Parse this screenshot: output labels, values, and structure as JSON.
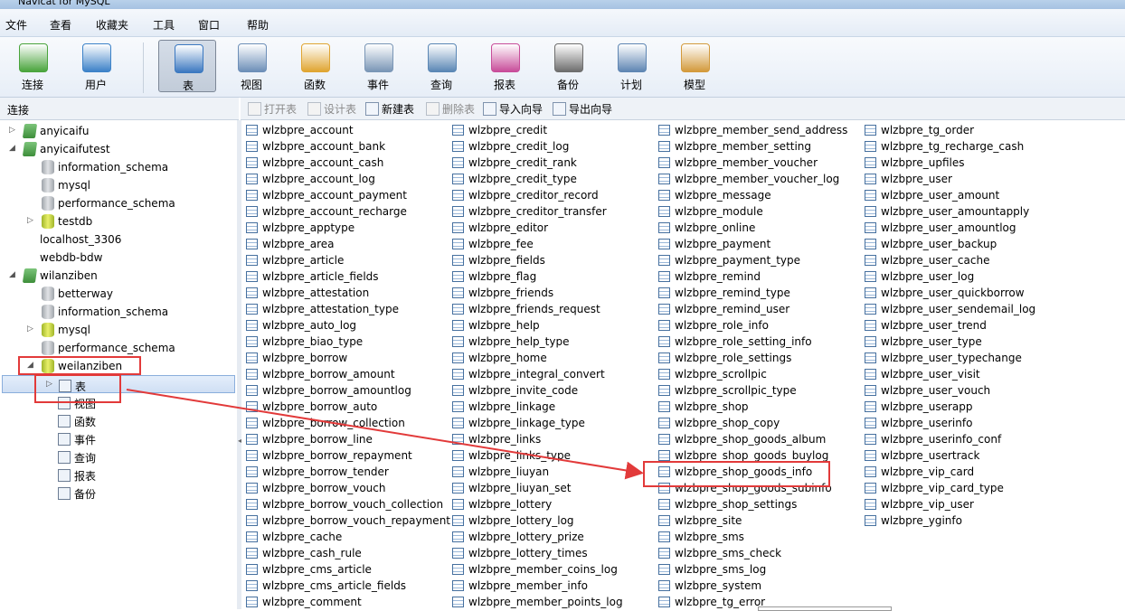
{
  "window": {
    "title": "Navicat for MySQL"
  },
  "menu": [
    "文件",
    "查看",
    "收藏夹",
    "工具",
    "窗口",
    "帮助"
  ],
  "toolbar": [
    {
      "label": "连接",
      "icon": "connection-icon",
      "color": "#4aa43c"
    },
    {
      "label": "用户",
      "icon": "user-icon",
      "color": "#3d82c8"
    },
    {
      "label": "表",
      "icon": "table-icon",
      "color": "#3b78c0"
    },
    {
      "label": "视图",
      "icon": "view-icon",
      "color": "#6d8fb8"
    },
    {
      "label": "函数",
      "icon": "function-icon",
      "color": "#e0a532"
    },
    {
      "label": "事件",
      "icon": "event-icon",
      "color": "#7a96b6"
    },
    {
      "label": "查询",
      "icon": "query-icon",
      "color": "#5b87b5"
    },
    {
      "label": "报表",
      "icon": "report-icon",
      "color": "#c84d9a"
    },
    {
      "label": "备份",
      "icon": "backup-icon",
      "color": "#6e6e6e"
    },
    {
      "label": "计划",
      "icon": "schedule-icon",
      "color": "#5f86b3"
    },
    {
      "label": "模型",
      "icon": "model-icon",
      "color": "#d39a3c"
    }
  ],
  "connection_header": "连接",
  "object_toolbar": [
    {
      "label": "打开表",
      "enabled": false
    },
    {
      "label": "设计表",
      "enabled": false
    },
    {
      "label": "新建表",
      "enabled": true
    },
    {
      "label": "删除表",
      "enabled": false
    },
    {
      "label": "导入向导",
      "enabled": true
    },
    {
      "label": "导出向导",
      "enabled": true
    }
  ],
  "tree": [
    {
      "label": "anyicaifu",
      "level": 0,
      "arrow": "▷",
      "icon": "conn"
    },
    {
      "label": "anyicaifutest",
      "level": 0,
      "arrow": "◢",
      "icon": "conn"
    },
    {
      "label": "information_schema",
      "level": 1,
      "arrow": "",
      "icon": "db"
    },
    {
      "label": "mysql",
      "level": 1,
      "arrow": "",
      "icon": "db"
    },
    {
      "label": "performance_schema",
      "level": 1,
      "arrow": "",
      "icon": "db"
    },
    {
      "label": "testdb",
      "level": 1,
      "arrow": "▷",
      "icon": "dbopen"
    },
    {
      "label": "localhost_3306",
      "level": 0,
      "arrow": "",
      "icon": "srv"
    },
    {
      "label": "webdb-bdw",
      "level": 0,
      "arrow": "",
      "icon": "srv"
    },
    {
      "label": "wilanziben",
      "level": 0,
      "arrow": "◢",
      "icon": "conn"
    },
    {
      "label": "betterway",
      "level": 1,
      "arrow": "",
      "icon": "db"
    },
    {
      "label": "information_schema",
      "level": 1,
      "arrow": "",
      "icon": "db"
    },
    {
      "label": "mysql",
      "level": 1,
      "arrow": "▷",
      "icon": "dbopen"
    },
    {
      "label": "performance_schema",
      "level": 1,
      "arrow": "",
      "icon": "db"
    },
    {
      "label": "weilanziben",
      "level": 1,
      "arrow": "◢",
      "icon": "dbopen"
    },
    {
      "label": "表",
      "level": 2,
      "arrow": "▷",
      "icon": "small",
      "selected": true
    },
    {
      "label": "视图",
      "level": 2,
      "arrow": "",
      "icon": "small"
    },
    {
      "label": "函数",
      "level": 2,
      "arrow": "",
      "icon": "small"
    },
    {
      "label": "事件",
      "level": 2,
      "arrow": "",
      "icon": "small"
    },
    {
      "label": "查询",
      "level": 2,
      "arrow": "",
      "icon": "small"
    },
    {
      "label": "报表",
      "level": 2,
      "arrow": "",
      "icon": "small"
    },
    {
      "label": "备份",
      "level": 2,
      "arrow": "",
      "icon": "small"
    }
  ],
  "table_columns": [
    [
      "wlzbpre_account",
      "wlzbpre_account_bank",
      "wlzbpre_account_cash",
      "wlzbpre_account_log",
      "wlzbpre_account_payment",
      "wlzbpre_account_recharge",
      "wlzbpre_apptype",
      "wlzbpre_area",
      "wlzbpre_article",
      "wlzbpre_article_fields",
      "wlzbpre_attestation",
      "wlzbpre_attestation_type",
      "wlzbpre_auto_log",
      "wlzbpre_biao_type",
      "wlzbpre_borrow",
      "wlzbpre_borrow_amount",
      "wlzbpre_borrow_amountlog",
      "wlzbpre_borrow_auto",
      "wlzbpre_borrow_collection",
      "wlzbpre_borrow_line",
      "wlzbpre_borrow_repayment",
      "wlzbpre_borrow_tender",
      "wlzbpre_borrow_vouch",
      "wlzbpre_borrow_vouch_collection",
      "wlzbpre_borrow_vouch_repayment",
      "wlzbpre_cache",
      "wlzbpre_cash_rule",
      "wlzbpre_cms_article",
      "wlzbpre_cms_article_fields",
      "wlzbpre_comment"
    ],
    [
      "wlzbpre_credit",
      "wlzbpre_credit_log",
      "wlzbpre_credit_rank",
      "wlzbpre_credit_type",
      "wlzbpre_creditor_record",
      "wlzbpre_creditor_transfer",
      "wlzbpre_editor",
      "wlzbpre_fee",
      "wlzbpre_fields",
      "wlzbpre_flag",
      "wlzbpre_friends",
      "wlzbpre_friends_request",
      "wlzbpre_help",
      "wlzbpre_help_type",
      "wlzbpre_home",
      "wlzbpre_integral_convert",
      "wlzbpre_invite_code",
      "wlzbpre_linkage",
      "wlzbpre_linkage_type",
      "wlzbpre_links",
      "wlzbpre_links_type",
      "wlzbpre_liuyan",
      "wlzbpre_liuyan_set",
      "wlzbpre_lottery",
      "wlzbpre_lottery_log",
      "wlzbpre_lottery_prize",
      "wlzbpre_lottery_times",
      "wlzbpre_member_coins_log",
      "wlzbpre_member_info",
      "wlzbpre_member_points_log"
    ],
    [
      "wlzbpre_member_send_address",
      "wlzbpre_member_setting",
      "wlzbpre_member_voucher",
      "wlzbpre_member_voucher_log",
      "wlzbpre_message",
      "wlzbpre_module",
      "wlzbpre_online",
      "wlzbpre_payment",
      "wlzbpre_payment_type",
      "wlzbpre_remind",
      "wlzbpre_remind_type",
      "wlzbpre_remind_user",
      "wlzbpre_role_info",
      "wlzbpre_role_setting_info",
      "wlzbpre_role_settings",
      "wlzbpre_scrollpic",
      "wlzbpre_scrollpic_type",
      "wlzbpre_shop",
      "wlzbpre_shop_copy",
      "wlzbpre_shop_goods_album",
      "wlzbpre_shop_goods_buylog",
      "wlzbpre_shop_goods_info",
      "wlzbpre_shop_goods_subinfo",
      "wlzbpre_shop_settings",
      "wlzbpre_site",
      "wlzbpre_sms",
      "wlzbpre_sms_check",
      "wlzbpre_sms_log",
      "wlzbpre_system",
      "wlzbpre_tg_error"
    ],
    [
      "wlzbpre_tg_order",
      "wlzbpre_tg_recharge_cash",
      "wlzbpre_upfiles",
      "wlzbpre_user",
      "wlzbpre_user_amount",
      "wlzbpre_user_amountapply",
      "wlzbpre_user_amountlog",
      "wlzbpre_user_backup",
      "wlzbpre_user_cache",
      "wlzbpre_user_log",
      "wlzbpre_user_quickborrow",
      "wlzbpre_user_sendemail_log",
      "wlzbpre_user_trend",
      "wlzbpre_user_type",
      "wlzbpre_user_typechange",
      "wlzbpre_user_visit",
      "wlzbpre_user_vouch",
      "wlzbpre_userapp",
      "wlzbpre_userinfo",
      "wlzbpre_userinfo_conf",
      "wlzbpre_usertrack",
      "wlzbpre_vip_card",
      "wlzbpre_vip_card_type",
      "wlzbpre_vip_user",
      "wlzbpre_yginfo"
    ]
  ],
  "annotation_color": "#e23a3a"
}
